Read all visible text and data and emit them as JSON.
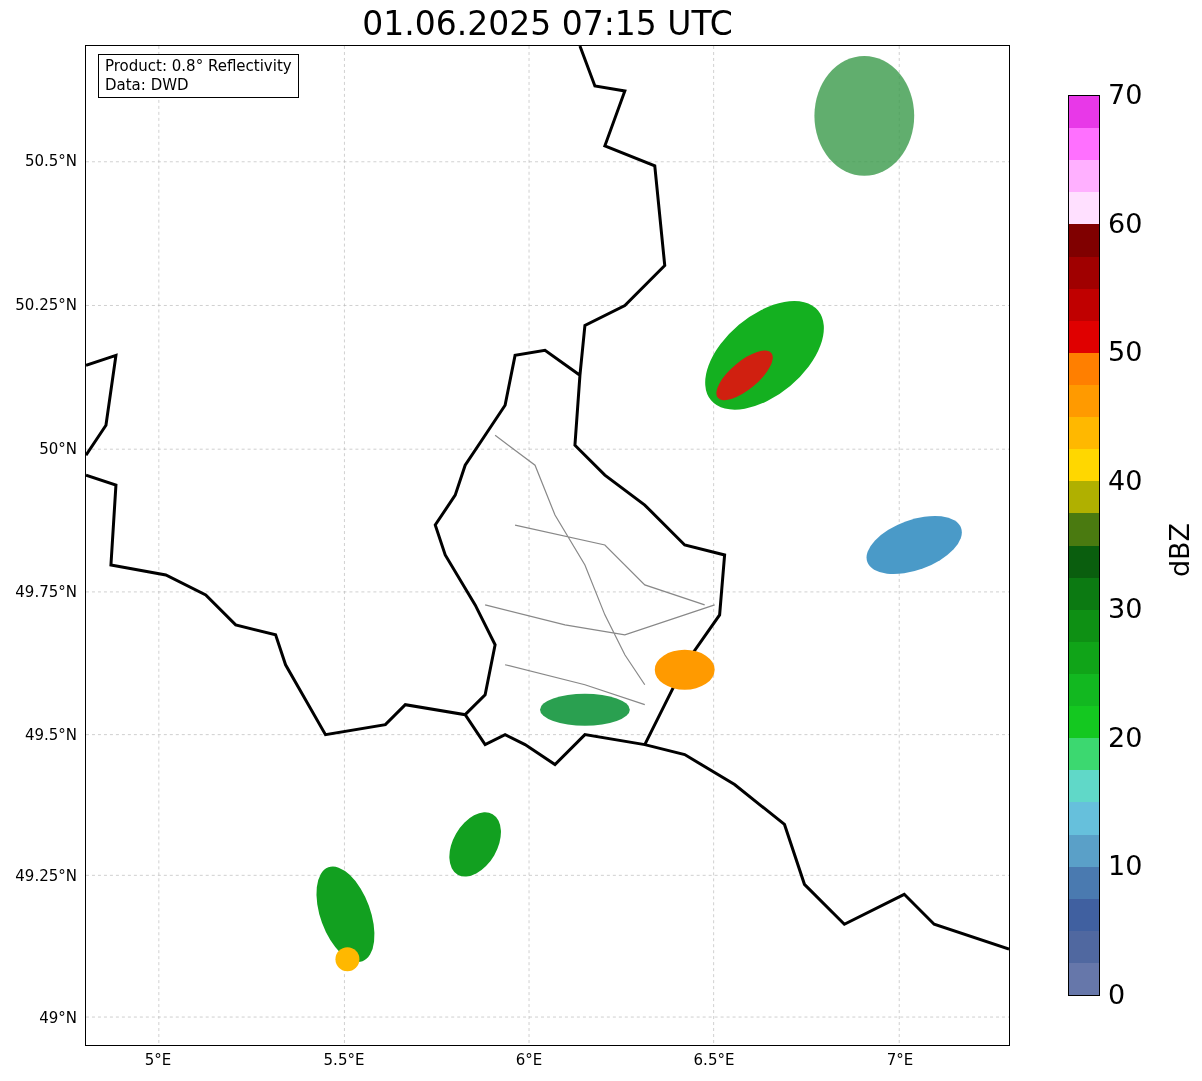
{
  "title": "01.06.2025 07:15 UTC",
  "map": {
    "info": [
      "Product: 0.8° Reflectivity",
      "Data: DWD"
    ],
    "lat_ticks": [
      "50.5°N",
      "50.25°N",
      "50°N",
      "49.75°N",
      "49.5°N",
      "49.25°N",
      "49°N"
    ],
    "lon_ticks": [
      "5°E",
      "5.5°E",
      "6°E",
      "6.5°E",
      "7°E"
    ]
  },
  "colorbar": {
    "label": "dBZ",
    "ticks": [
      "70",
      "60",
      "50",
      "40",
      "30",
      "20",
      "10",
      "0"
    ],
    "bands": [
      {
        "color": "#e838e8"
      },
      {
        "color": "#ff70ff"
      },
      {
        "color": "#ffb0ff"
      },
      {
        "color": "#ffe0ff"
      },
      {
        "color": "#800000"
      },
      {
        "color": "#a00000"
      },
      {
        "color": "#c00000"
      },
      {
        "color": "#e00000"
      },
      {
        "color": "#ff7f00"
      },
      {
        "color": "#ff9a00"
      },
      {
        "color": "#ffb800"
      },
      {
        "color": "#ffd700"
      },
      {
        "color": "#b0b000"
      },
      {
        "color": "#4a7a10"
      },
      {
        "color": "#0a5e0e"
      },
      {
        "color": "#0c7a12"
      },
      {
        "color": "#0e9014"
      },
      {
        "color": "#10a418"
      },
      {
        "color": "#12b820"
      },
      {
        "color": "#14c820"
      },
      {
        "color": "#3cd870"
      },
      {
        "color": "#60d8c8"
      },
      {
        "color": "#66c0dc"
      },
      {
        "color": "#5aa0c8"
      },
      {
        "color": "#4a7ab0"
      },
      {
        "color": "#4060a0"
      },
      {
        "color": "#5068a0"
      },
      {
        "color": "#6677aa"
      }
    ]
  }
}
